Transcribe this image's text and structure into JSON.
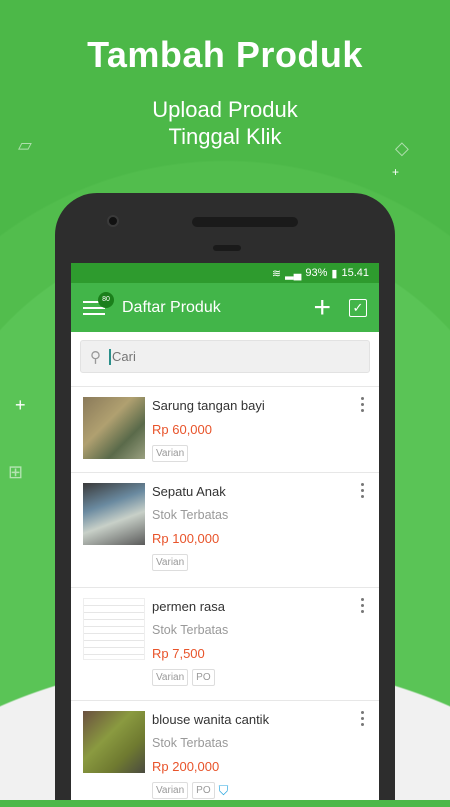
{
  "headline": "Tambah Produk",
  "subtitle_line1": "Upload Produk",
  "subtitle_line2": "Tinggal Klik",
  "status": {
    "battery": "93%",
    "time": "15.41"
  },
  "toolbar": {
    "title": "Daftar Produk",
    "badge": "80",
    "add_icon": "plus-icon",
    "select_icon": "checkbox-icon"
  },
  "search": {
    "placeholder": "Cari"
  },
  "products": [
    {
      "name": "Sarung tangan bayi",
      "stock": "",
      "price": "Rp 60,000",
      "tags": [
        "Varian"
      ]
    },
    {
      "name": "Sepatu Anak",
      "stock": "Stok Terbatas",
      "price": "Rp 100,000",
      "tags": [
        "Varian"
      ]
    },
    {
      "name": "permen rasa",
      "stock": "Stok Terbatas",
      "price": "Rp 7,500",
      "tags": [
        "Varian",
        "PO"
      ]
    },
    {
      "name": "blouse wanita cantik",
      "stock": "Stok Terbatas",
      "price": "Rp 200,000",
      "tags": [
        "Varian",
        "PO"
      ]
    }
  ],
  "colors": {
    "brand": "#42b549",
    "price": "#e8542b"
  }
}
